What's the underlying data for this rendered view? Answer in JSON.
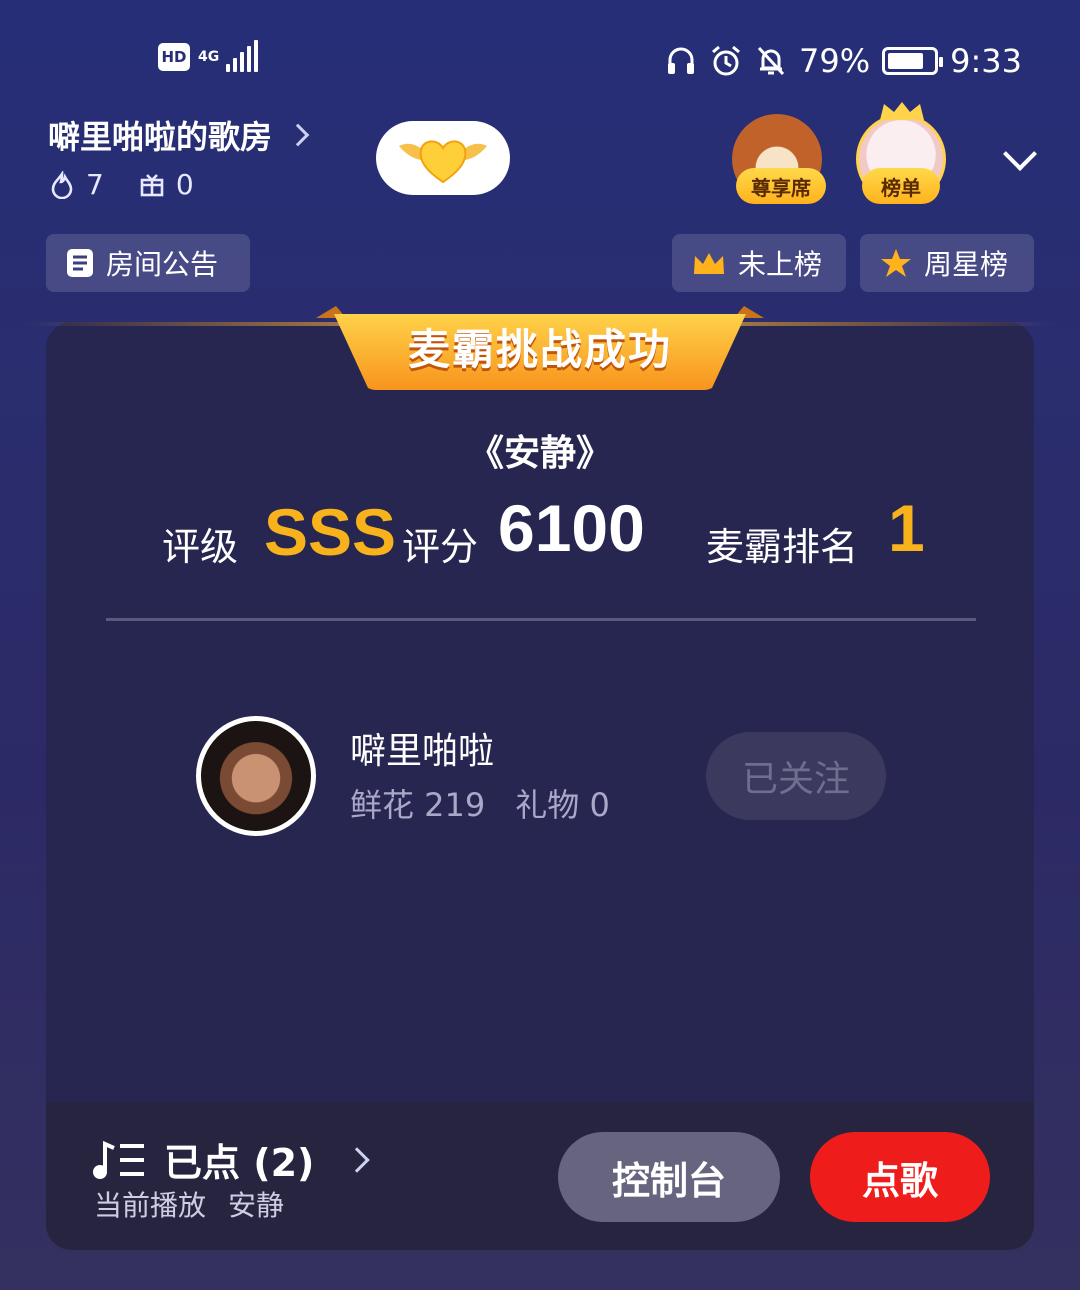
{
  "status_bar": {
    "hd": "HD",
    "network": "4G",
    "battery": "79%",
    "battery_level": 0.79,
    "time": "9:33"
  },
  "header": {
    "room_title": "噼里啪啦的歌房",
    "hot_count": "7",
    "gift_count": "0",
    "seat_vip_label": "尊享席",
    "seat_rank_label": "榜单"
  },
  "chips": {
    "announcement": "房间公告",
    "not_ranked": "未上榜",
    "weekly_star": "周星榜"
  },
  "result": {
    "banner": "麦霸挑战成功",
    "song_title": "《安静》",
    "grade_label": "评级",
    "grade_value": "SSS",
    "score_label": "评分",
    "score_value": "6100",
    "rank_label": "麦霸排名",
    "rank_value": "1"
  },
  "singer": {
    "name": "噼里啪啦",
    "flowers": "鲜花 219",
    "gifts": "礼物 0",
    "follow_label": "已关注"
  },
  "bottom": {
    "queue_label": "已点",
    "queue_count": "(2)",
    "now_playing_label": "当前播放",
    "now_playing_song": "安静",
    "console_label": "控制台",
    "order_label": "点歌"
  },
  "colors": {
    "gold": "#f7b21c",
    "order_red": "#ef1c1c",
    "card_bg": "#272650"
  }
}
